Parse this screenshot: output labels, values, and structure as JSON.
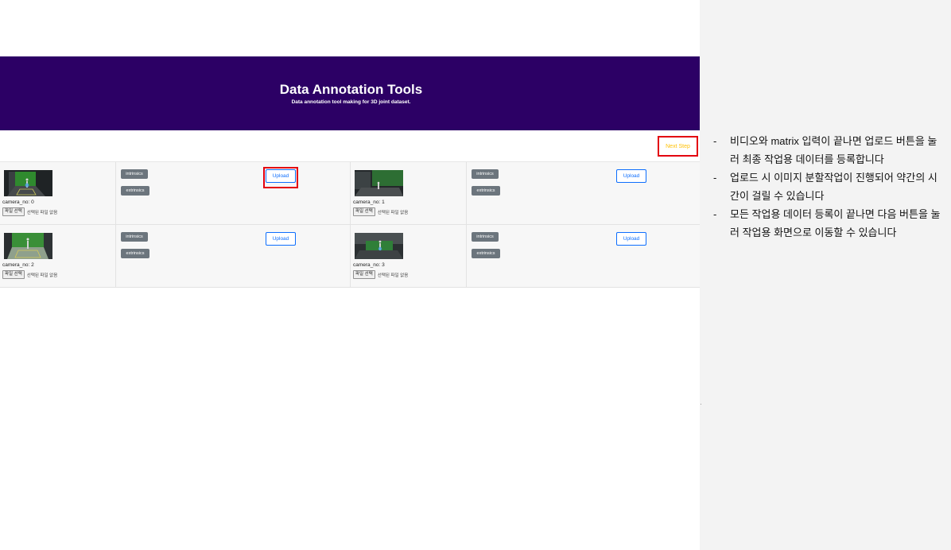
{
  "header": {
    "title": "Data Annotation Tools",
    "subtitle": "Data annotation tool making for 3D joint dataset."
  },
  "toolbar": {
    "next_label": "Next Step"
  },
  "cameras": [
    {
      "label": "camera_no: 0",
      "file_button": "파일 선택",
      "file_status": "선택된 파일 없음",
      "intrinsics_label": "intrinsics",
      "extrinsics_label": "extrinsics",
      "upload_label": "Upload"
    },
    {
      "label": "camera_no: 1",
      "file_button": "파일 선택",
      "file_status": "선택된 파일 없음",
      "intrinsics_label": "intrinsics",
      "extrinsics_label": "extrinsics",
      "upload_label": "Upload"
    },
    {
      "label": "camera_no: 2",
      "file_button": "파일 선택",
      "file_status": "선택된 파일 없음",
      "intrinsics_label": "intrinsics",
      "extrinsics_label": "extrinsics",
      "upload_label": "Upload"
    },
    {
      "label": "camera_no: 3",
      "file_button": "파일 선택",
      "file_status": "선택된 파일 없음",
      "intrinsics_label": "intrinsics",
      "extrinsics_label": "extrinsics",
      "upload_label": "Upload"
    }
  ],
  "notes": [
    "비디오와 matrix 입력이 끝나면 업로드 버튼을 눌러 최종 작업용 데이터를 등록합니다",
    "업로드 시 이미지 분할작업이 진행되어 약간의 시간이 걸릴 수 있습니다",
    "모든 작업용 데이터 등록이 끝나면 다음 버튼을 눌러 작업용 화면으로 이동할 수 있습니다"
  ],
  "colors": {
    "header_bg": "#2c0065",
    "highlight": "#e3000f",
    "next_text": "#ffc107",
    "upload_blue": "#0d6efd",
    "badge_gray": "#6c757d",
    "panel_bg": "#f3f3f3"
  },
  "icons": {
    "thumbnail": "video-frame-thumbnail-icon",
    "note_marker": "dash-bullet-icon"
  }
}
